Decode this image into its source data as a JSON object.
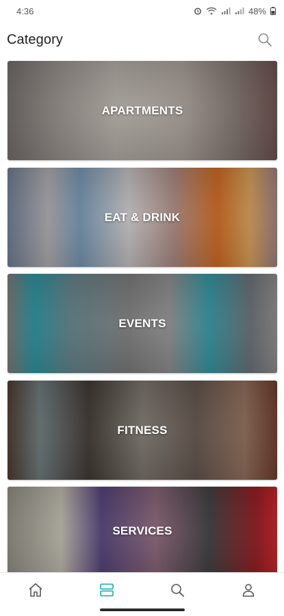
{
  "status_bar": {
    "time": "4:36",
    "battery": "48%"
  },
  "header": {
    "title": "Category"
  },
  "categories": [
    {
      "label": "APARTMENTS"
    },
    {
      "label": "EAT & DRINK"
    },
    {
      "label": "EVENTS"
    },
    {
      "label": "FITNESS"
    },
    {
      "label": "SERVICES"
    }
  ],
  "bottom_nav": {
    "items": [
      {
        "icon": "home-icon"
      },
      {
        "icon": "category-icon",
        "active": true
      },
      {
        "icon": "search-icon"
      },
      {
        "icon": "profile-icon"
      }
    ],
    "active_color": "#2bb3b9",
    "inactive_color": "#555555"
  }
}
